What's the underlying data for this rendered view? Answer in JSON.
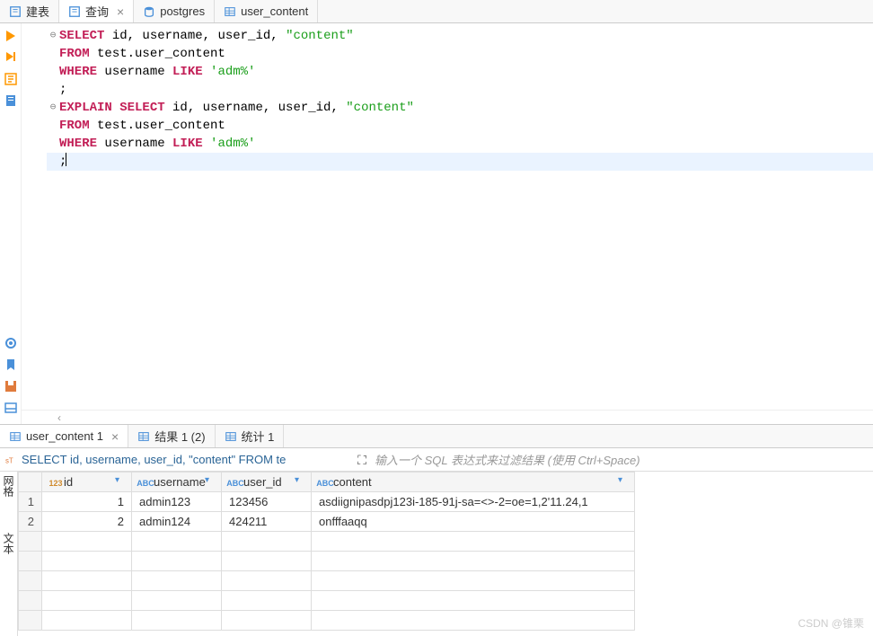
{
  "tabs_top": [
    {
      "label": "<postgres> 建表",
      "icon": "sql-icon",
      "active": false,
      "closable": false
    },
    {
      "label": "<postgres> 查询",
      "icon": "sql-icon",
      "active": true,
      "closable": true
    },
    {
      "label": "postgres",
      "icon": "db-icon",
      "active": false,
      "closable": false
    },
    {
      "label": "user_content",
      "icon": "table-icon",
      "active": false,
      "closable": false
    }
  ],
  "editor": {
    "lines": [
      {
        "fold": true,
        "tokens": [
          {
            "t": "kw",
            "v": "SELECT"
          },
          {
            "t": "id",
            "v": " id, username, user_id, "
          },
          {
            "t": "str",
            "v": "\"content\""
          }
        ]
      },
      {
        "tokens": [
          {
            "t": "kw",
            "v": "FROM"
          },
          {
            "t": "id",
            "v": " test.user_content"
          }
        ]
      },
      {
        "tokens": [
          {
            "t": "kw",
            "v": "WHERE"
          },
          {
            "t": "id",
            "v": " username "
          },
          {
            "t": "kw",
            "v": "LIKE"
          },
          {
            "t": "id",
            "v": " "
          },
          {
            "t": "str",
            "v": "'adm%'"
          }
        ]
      },
      {
        "tokens": [
          {
            "t": "id",
            "v": ";"
          }
        ]
      },
      {
        "tokens": []
      },
      {
        "fold": true,
        "tokens": [
          {
            "t": "kw",
            "v": "EXPLAIN SELECT"
          },
          {
            "t": "id",
            "v": " id, username, user_id, "
          },
          {
            "t": "str",
            "v": "\"content\""
          }
        ]
      },
      {
        "tokens": [
          {
            "t": "kw",
            "v": "FROM"
          },
          {
            "t": "id",
            "v": " test.user_content"
          }
        ]
      },
      {
        "tokens": [
          {
            "t": "kw",
            "v": "WHERE"
          },
          {
            "t": "id",
            "v": " username "
          },
          {
            "t": "kw",
            "v": "LIKE"
          },
          {
            "t": "id",
            "v": " "
          },
          {
            "t": "str",
            "v": "'adm%'"
          }
        ]
      },
      {
        "cursor": true,
        "tokens": [
          {
            "t": "id",
            "v": ";"
          }
        ]
      }
    ]
  },
  "bottom_tabs": [
    {
      "label": "user_content 1",
      "icon": "table-icon",
      "active": true,
      "closable": true
    },
    {
      "label": "结果 1 (2)",
      "icon": "table-icon",
      "active": false
    },
    {
      "label": "统计 1",
      "icon": "table-icon",
      "active": false
    }
  ],
  "filter_bar": {
    "sql_preview": "SELECT id, username, user_id, \"content\" FROM te",
    "placeholder": "输入一个 SQL 表达式来过滤结果 (使用 Ctrl+Space)"
  },
  "grid_side_labels": [
    "网格",
    "文本"
  ],
  "columns": [
    {
      "name": "id",
      "type": "num"
    },
    {
      "name": "username",
      "type": "text"
    },
    {
      "name": "user_id",
      "type": "text"
    },
    {
      "name": "content",
      "type": "text"
    }
  ],
  "rows": [
    {
      "n": 1,
      "id": 1,
      "username": "admin123",
      "user_id": "123456",
      "content": "asdiignipasdpj123i-185-91j-sa=<>-2=oe=1,2'11.24,1"
    },
    {
      "n": 2,
      "id": 2,
      "username": "admin124",
      "user_id": "424211",
      "content": "onfffaaqq"
    }
  ],
  "watermark": "CSDN @锥栗"
}
